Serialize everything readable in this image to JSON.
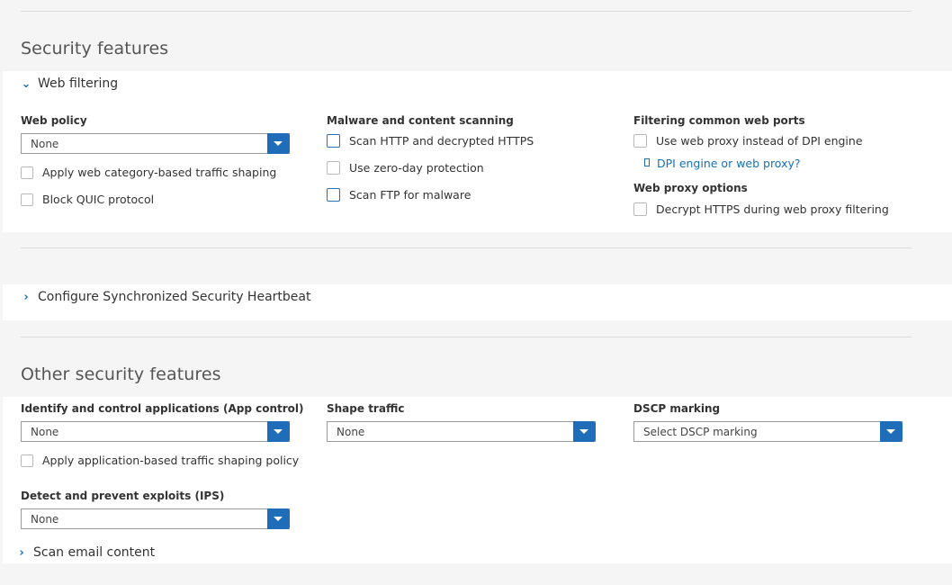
{
  "security_features": {
    "heading": "Security features",
    "web_filtering": {
      "title": "Web filtering",
      "web_policy": {
        "label": "Web policy",
        "value": "None"
      },
      "apply_category_shaping": "Apply web category-based traffic shaping",
      "block_quic": "Block QUIC protocol",
      "malware_scanning": {
        "label": "Malware and content scanning",
        "scan_http": "Scan HTTP and decrypted HTTPS",
        "zero_day": "Use zero-day protection",
        "scan_ftp": "Scan FTP for malware"
      },
      "filtering_ports": {
        "label": "Filtering common web ports",
        "use_web_proxy": "Use web proxy instead of DPI engine",
        "dpi_link": "DPI engine or web proxy?"
      },
      "web_proxy_options": {
        "label": "Web proxy options",
        "decrypt_https": "Decrypt HTTPS during web proxy filtering"
      }
    }
  },
  "heartbeat": {
    "title": "Configure Synchronized Security Heartbeat"
  },
  "other_security_features": {
    "heading": "Other security features",
    "app_control": {
      "label": "Identify and control applications (App control)",
      "value": "None"
    },
    "apply_app_shaping": "Apply application-based traffic shaping policy",
    "shape_traffic": {
      "label": "Shape traffic",
      "value": "None"
    },
    "dscp_marking": {
      "label": "DSCP marking",
      "value": "Select DSCP marking"
    },
    "ips": {
      "label": "Detect and prevent exploits (IPS)",
      "value": "None"
    },
    "scan_email": "Scan email content"
  },
  "colors": {
    "accent": "#1f6db8",
    "link": "#1a6fb5",
    "panel": "#ffffff",
    "background": "#f5f5f5"
  },
  "icons": {
    "expanded": "chevron-down-icon",
    "collapsed": "chevron-right-icon",
    "help": "help-link-icon"
  }
}
